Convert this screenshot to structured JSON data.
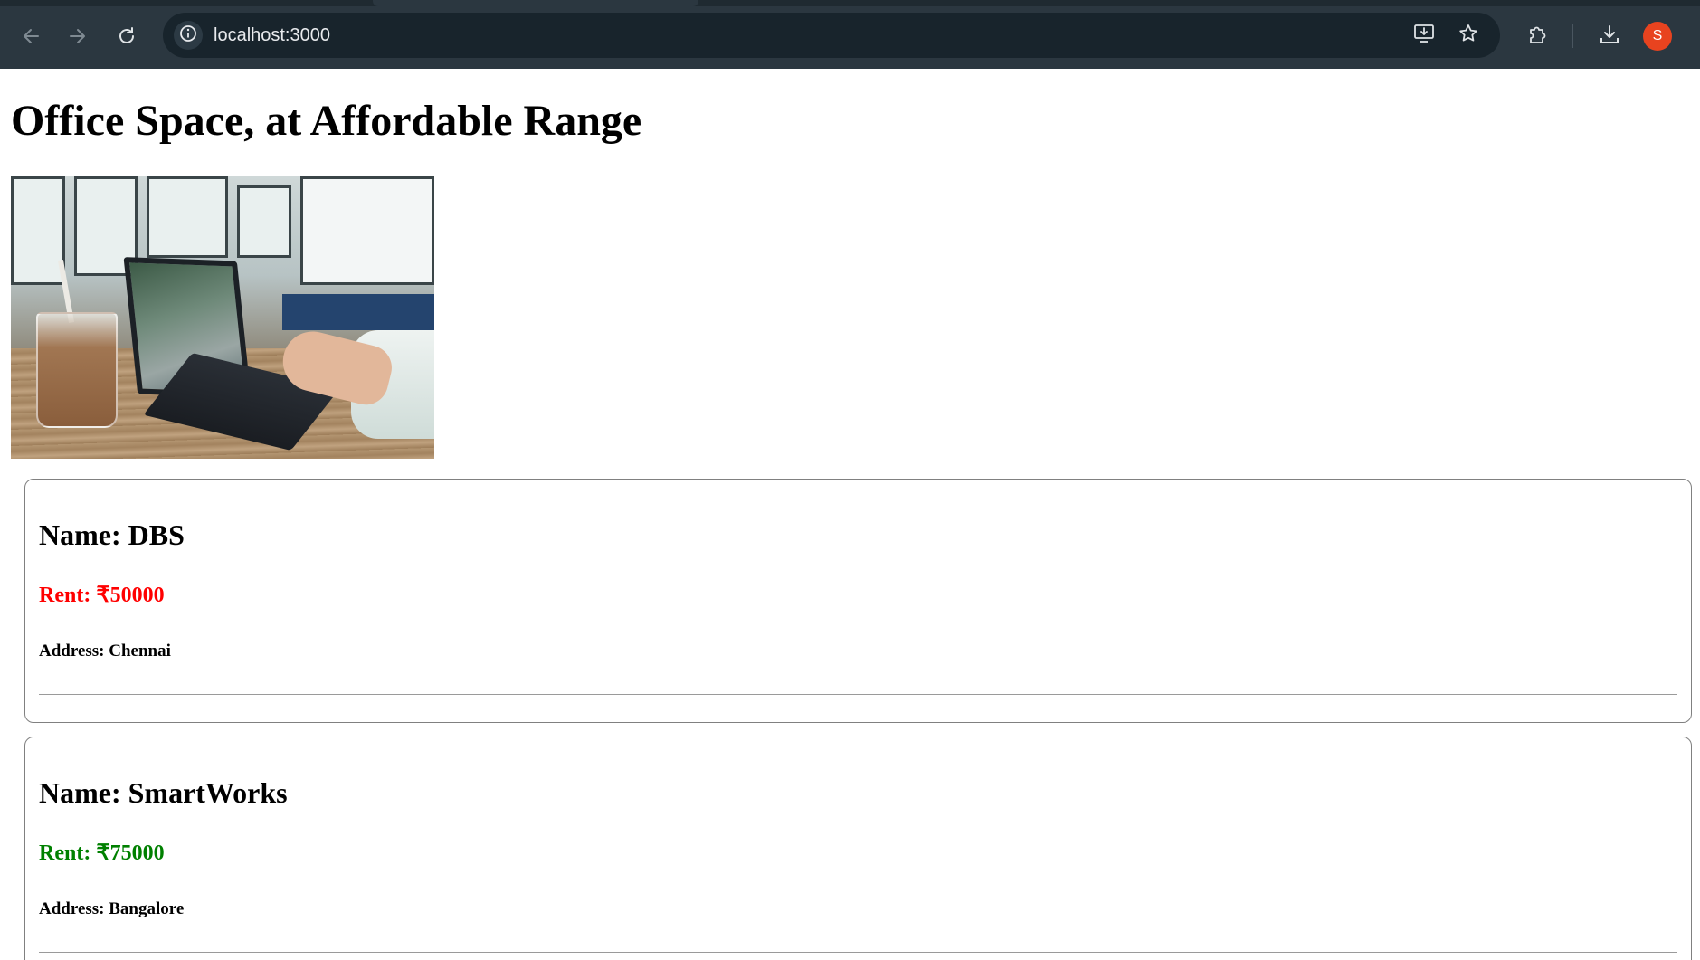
{
  "browser": {
    "url": "localhost:3000",
    "profile_initial": "S",
    "icons": {
      "back": "back-arrow-icon",
      "forward": "forward-arrow-icon",
      "reload": "reload-icon",
      "site_info": "info-icon",
      "install_app": "install-app-icon",
      "bookmark": "star-icon",
      "extensions": "puzzle-icon",
      "downloads": "download-icon"
    },
    "colors": {
      "toolbar": "#2b3740",
      "omnibox": "#18242c",
      "avatar": "#e8431f"
    }
  },
  "page": {
    "title": "Office Space, at Affordable Range",
    "image_description": "office-photo",
    "offices": [
      {
        "name_label": "Name: DBS",
        "rent_label": "Rent: ₹50000",
        "rent_color": "#ff0000",
        "address_label": "Address: Chennai"
      },
      {
        "name_label": "Name: SmartWorks",
        "rent_label": "Rent: ₹75000",
        "rent_color": "#008000",
        "address_label": "Address: Bangalore"
      }
    ]
  }
}
